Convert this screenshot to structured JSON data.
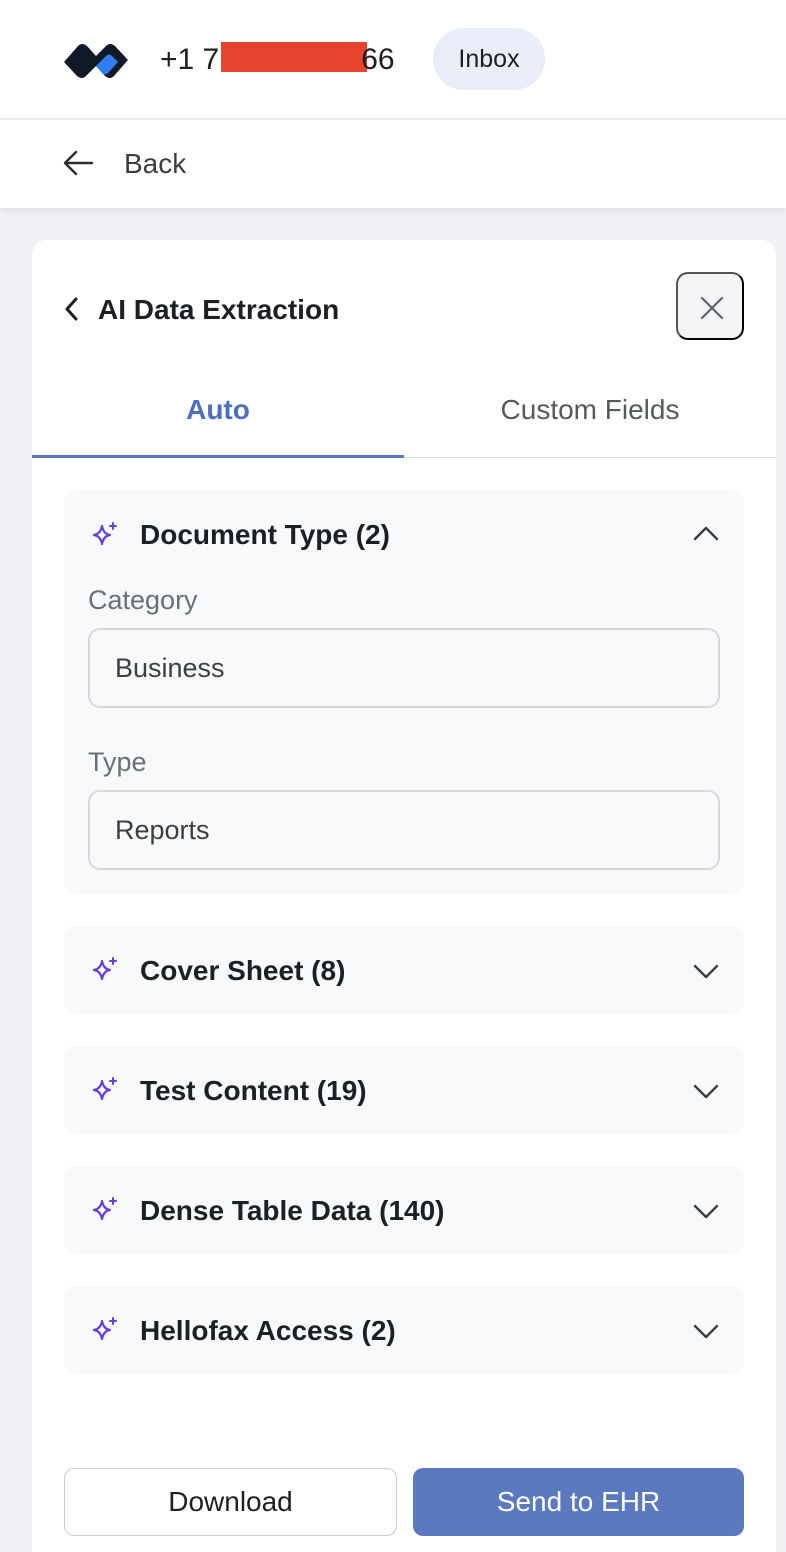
{
  "header": {
    "phone_prefix": "+1 7",
    "phone_suffix": "66",
    "inbox_label": "Inbox"
  },
  "nav": {
    "back_label": "Back"
  },
  "panel": {
    "title": "AI Data Extraction",
    "tabs": [
      {
        "label": "Auto",
        "active": true
      },
      {
        "label": "Custom Fields",
        "active": false
      }
    ]
  },
  "sections": [
    {
      "title": "Document Type (2)",
      "expanded": true,
      "fields": [
        {
          "label": "Category",
          "value": "Business"
        },
        {
          "label": "Type",
          "value": "Reports"
        }
      ]
    },
    {
      "title": "Cover Sheet (8)",
      "expanded": false
    },
    {
      "title": "Test Content (19)",
      "expanded": false
    },
    {
      "title": "Dense Table Data (140)",
      "expanded": false
    },
    {
      "title": "Hellofax Access (2)",
      "expanded": false
    }
  ],
  "actions": {
    "download_label": "Download",
    "send_label": "Send to EHR"
  },
  "colors": {
    "accent": "#5a79bf",
    "sparkle": "#6a3fd6",
    "redaction": "#e8432d"
  },
  "icons": [
    "logo-icon",
    "back-arrow-icon",
    "chevron-left-icon",
    "close-icon",
    "sparkle-icon",
    "chevron-up-icon",
    "chevron-down-icon"
  ]
}
